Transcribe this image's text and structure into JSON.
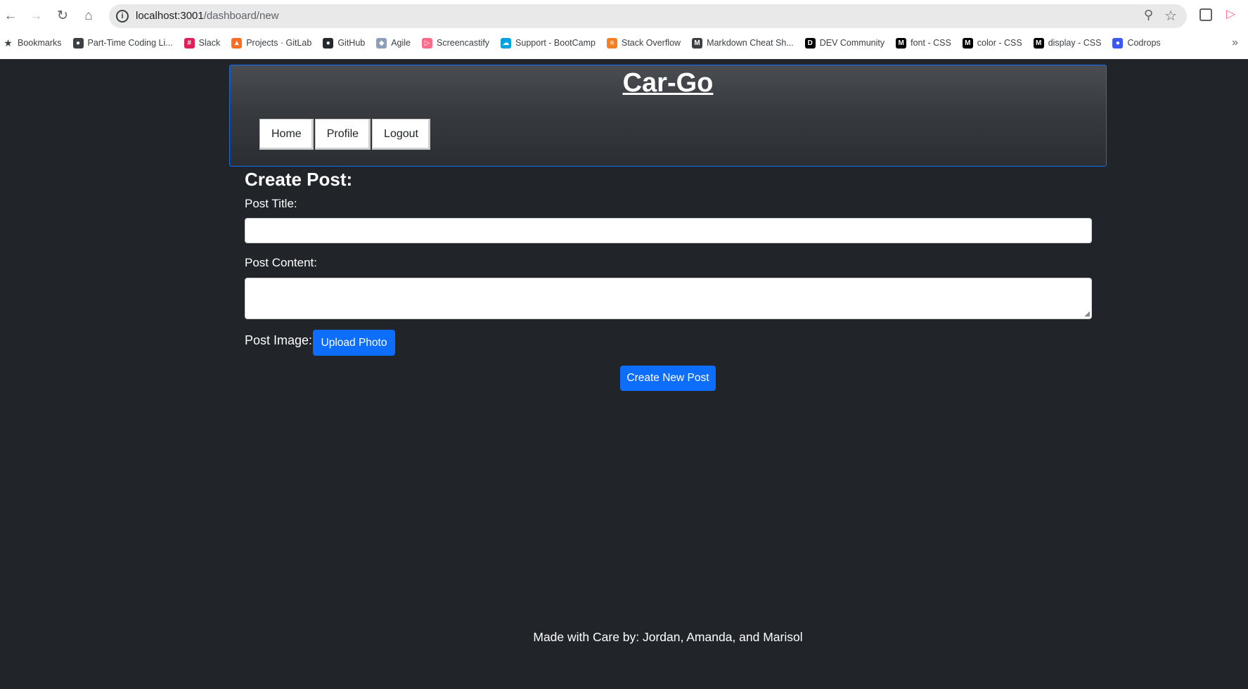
{
  "browser": {
    "url_host": "localhost:3001",
    "url_path": "/dashboard/new",
    "bookmarks": [
      {
        "label": "Bookmarks",
        "icon": "star-icon",
        "color": "#3c4043"
      },
      {
        "label": "Part-Time Coding Li...",
        "icon": "globe-icon",
        "color": "#3c4043"
      },
      {
        "label": "Slack",
        "icon": "slack-icon",
        "color": "#e01e5a"
      },
      {
        "label": "Projects · GitLab",
        "icon": "gitlab-icon",
        "color": "#fc6d26"
      },
      {
        "label": "GitHub",
        "icon": "github-icon",
        "color": "#24292f"
      },
      {
        "label": "Agile",
        "icon": "agile-icon",
        "color": "#8aa0b8"
      },
      {
        "label": "Screencastify",
        "icon": "screencastify-icon",
        "color": "#ff6b8b"
      },
      {
        "label": "Support - BootCamp",
        "icon": "salesforce-icon",
        "color": "#00a1e0"
      },
      {
        "label": "Stack Overflow",
        "icon": "stackoverflow-icon",
        "color": "#f48024"
      },
      {
        "label": "Markdown Cheat Sh...",
        "icon": "markdown-icon",
        "color": "#3c4043"
      },
      {
        "label": "DEV Community",
        "icon": "dev-icon",
        "color": "#000000"
      },
      {
        "label": "font - CSS",
        "icon": "mdn-icon",
        "color": "#000000"
      },
      {
        "label": "color - CSS",
        "icon": "mdn-icon",
        "color": "#000000"
      },
      {
        "label": "display - CSS",
        "icon": "mdn-icon",
        "color": "#000000"
      },
      {
        "label": "Codrops",
        "icon": "codrops-icon",
        "color": "#3c5af0"
      }
    ]
  },
  "header": {
    "title": "Car-Go",
    "nav": [
      "Home",
      "Profile",
      "Logout"
    ]
  },
  "form": {
    "heading": "Create Post:",
    "title_label": "Post Title:",
    "title_value": "",
    "content_label": "Post Content:",
    "content_value": "",
    "image_label": "Post Image:",
    "upload_label": "Upload Photo",
    "submit_label": "Create New Post"
  },
  "footer": {
    "text": "Made with Care by: Jordan, Amanda, and Marisol"
  },
  "colors": {
    "page_bg": "#212529",
    "accent": "#0d6efd",
    "text": "#ffffff"
  }
}
